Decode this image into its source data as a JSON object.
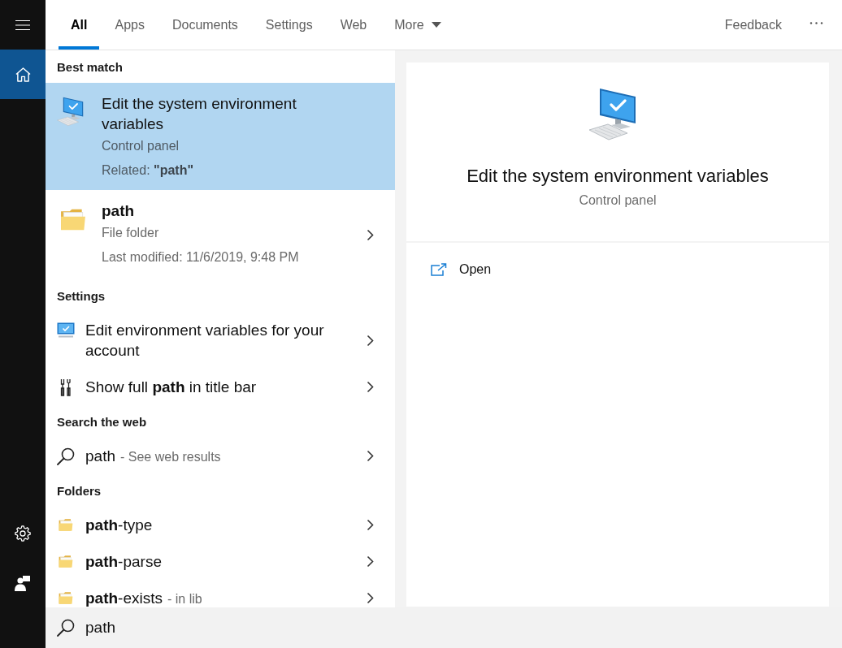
{
  "sidebar": {
    "top": [
      {
        "kind": "menu",
        "selected": false
      },
      {
        "kind": "home",
        "selected": true
      }
    ],
    "bottom": [
      {
        "kind": "settings",
        "selected": false
      },
      {
        "kind": "account",
        "selected": false
      }
    ]
  },
  "tabs": [
    {
      "label": "All",
      "selected": true,
      "dropdown": false
    },
    {
      "label": "Apps",
      "selected": false,
      "dropdown": false
    },
    {
      "label": "Documents",
      "selected": false,
      "dropdown": false
    },
    {
      "label": "Settings",
      "selected": false,
      "dropdown": false
    },
    {
      "label": "Web",
      "selected": false,
      "dropdown": false
    },
    {
      "label": "More",
      "selected": false,
      "dropdown": true
    }
  ],
  "feedback": "Feedback",
  "results": [
    {
      "heading": "Best match",
      "items": [
        {
          "kind": "app",
          "title": "Edit the system environment variables",
          "lines": [
            "Control panel",
            "Related: **\"path\"**"
          ],
          "selected": true
        },
        {
          "kind": "file",
          "title": "path",
          "lines": [
            "File folder",
            "Last modified: 11/6/2019, 9:48 PM"
          ],
          "selected": false
        }
      ]
    },
    {
      "heading": "Settings",
      "items": [
        {
          "kind": "display",
          "title": "Edit environment variables for your account",
          "selected": false
        },
        {
          "kind": "tools",
          "title": "Show full **path** in title bar",
          "selected": false
        }
      ]
    },
    {
      "heading": "Search the web",
      "items": [
        {
          "kind": "web",
          "title": "path",
          "hint": "- See web results",
          "selected": false
        }
      ]
    },
    {
      "heading": "Folders",
      "items": [
        {
          "kind": "folder",
          "title": "**path**-type",
          "selected": false
        },
        {
          "kind": "folder",
          "title": "**path**-parse",
          "selected": false
        },
        {
          "kind": "folder",
          "title": "**path**-exists",
          "hint": "- in lib",
          "selected": false
        }
      ]
    }
  ],
  "preview": {
    "title": "Edit the system environment variables",
    "subtitle": "Control panel",
    "actions": [
      {
        "label": "Open"
      }
    ]
  },
  "search": {
    "value": "path"
  }
}
